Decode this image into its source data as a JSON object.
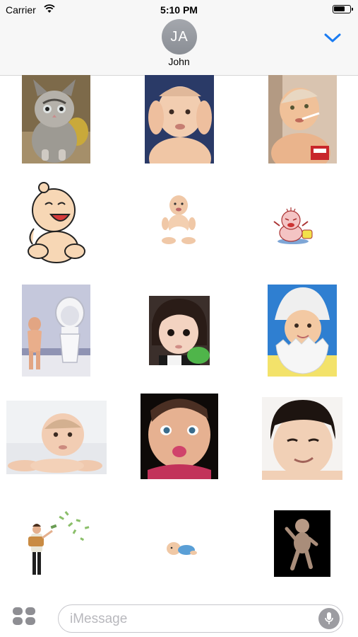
{
  "status_bar": {
    "carrier": "Carrier",
    "time": "5:10 PM",
    "battery_level": 0.75
  },
  "header": {
    "avatar_initials": "JA",
    "contact_name": "John",
    "collapse_icon": "chevron-down-icon",
    "accent_color": "#1b7cf2"
  },
  "stickers": [
    {
      "name": "kitten-sticker",
      "kind": "photo"
    },
    {
      "name": "baby-covering-ears-sticker",
      "kind": "photo"
    },
    {
      "name": "baby-with-cigarette-sticker",
      "kind": "photo"
    },
    {
      "name": "cartoon-laughing-baby-sticker",
      "kind": "cartoon"
    },
    {
      "name": "sitting-baby-sticker",
      "kind": "photo"
    },
    {
      "name": "cartoon-crying-baby-sticker",
      "kind": "cartoon"
    },
    {
      "name": "baby-at-toilet-sticker",
      "kind": "photo"
    },
    {
      "name": "baby-girl-sticker",
      "kind": "photo"
    },
    {
      "name": "baby-in-eggshell-sticker",
      "kind": "photo"
    },
    {
      "name": "baby-lying-down-sticker",
      "kind": "photo"
    },
    {
      "name": "baby-kissy-face-sticker",
      "kind": "photo"
    },
    {
      "name": "baby-smirking-sticker",
      "kind": "photo"
    },
    {
      "name": "man-throwing-money-sticker",
      "kind": "cartoon"
    },
    {
      "name": "crawling-baby-sticker",
      "kind": "cartoon"
    },
    {
      "name": "dancing-baby-sticker",
      "kind": "photo"
    }
  ],
  "compose": {
    "apps_icon": "app-drawer-icon",
    "placeholder": "iMessage",
    "value": "",
    "mic_icon": "microphone-icon"
  }
}
